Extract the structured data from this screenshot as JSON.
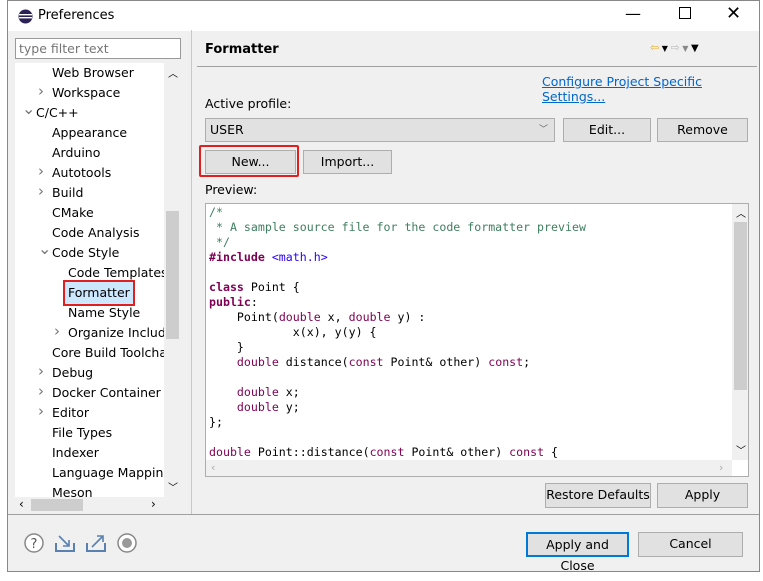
{
  "window": {
    "title": "Preferences",
    "controls": [
      "minimize",
      "maximize",
      "close"
    ]
  },
  "sidebar": {
    "filter_placeholder": "type filter text",
    "items": [
      {
        "label": "Web Browser",
        "level": 1,
        "chevron": ""
      },
      {
        "label": "Workspace",
        "level": 1,
        "chevron": "right"
      },
      {
        "label": "C/C++",
        "level": 0,
        "chevron": "down"
      },
      {
        "label": "Appearance",
        "level": 1,
        "chevron": ""
      },
      {
        "label": "Arduino",
        "level": 1,
        "chevron": ""
      },
      {
        "label": "Autotools",
        "level": 1,
        "chevron": "right"
      },
      {
        "label": "Build",
        "level": 1,
        "chevron": "right"
      },
      {
        "label": "CMake",
        "level": 1,
        "chevron": ""
      },
      {
        "label": "Code Analysis",
        "level": 1,
        "chevron": ""
      },
      {
        "label": "Code Style",
        "level": 1,
        "chevron": "down"
      },
      {
        "label": "Code Templates",
        "level": 2,
        "chevron": ""
      },
      {
        "label": "Formatter",
        "level": 2,
        "chevron": "",
        "selected": true
      },
      {
        "label": "Name Style",
        "level": 2,
        "chevron": ""
      },
      {
        "label": "Organize Includes",
        "level": 2,
        "chevron": "right"
      },
      {
        "label": "Core Build Toolchains",
        "level": 1,
        "chevron": ""
      },
      {
        "label": "Debug",
        "level": 1,
        "chevron": "right"
      },
      {
        "label": "Docker Container",
        "level": 1,
        "chevron": "right"
      },
      {
        "label": "Editor",
        "level": 1,
        "chevron": "right"
      },
      {
        "label": "File Types",
        "level": 1,
        "chevron": ""
      },
      {
        "label": "Indexer",
        "level": 1,
        "chevron": ""
      },
      {
        "label": "Language Mappings",
        "level": 1,
        "chevron": ""
      },
      {
        "label": "Meson",
        "level": 1,
        "chevron": ""
      }
    ]
  },
  "main": {
    "title": "Formatter",
    "config_link": "Configure Project Specific Settings...",
    "active_profile_label": "Active profile:",
    "profile_value": "USER",
    "edit_label": "Edit...",
    "remove_label": "Remove",
    "new_label": "New...",
    "import_label": "Import...",
    "preview_label": "Preview:",
    "code_lines": [
      [
        [
          "/*",
          "comment"
        ]
      ],
      [
        [
          " * A sample source file for the code formatter preview",
          "comment"
        ]
      ],
      [
        [
          " */",
          "comment"
        ]
      ],
      [
        [
          "#include",
          "kwb"
        ],
        [
          " ",
          ""
        ],
        [
          "<math.h>",
          "str"
        ]
      ],
      [],
      [
        [
          "class",
          "kwb"
        ],
        [
          " Point {",
          ""
        ]
      ],
      [
        [
          "public",
          "kwb"
        ],
        [
          ":",
          ""
        ]
      ],
      [
        [
          "    Point(",
          ""
        ],
        [
          "double",
          "kw"
        ],
        [
          " x, ",
          ""
        ],
        [
          "double",
          "kw"
        ],
        [
          " y) :",
          ""
        ]
      ],
      [
        [
          "            x(x), y(y) {",
          ""
        ]
      ],
      [
        [
          "    }",
          ""
        ]
      ],
      [
        [
          "    ",
          ""
        ],
        [
          "double",
          "kw"
        ],
        [
          " distance(",
          ""
        ],
        [
          "const",
          "kw"
        ],
        [
          " Point& other) ",
          ""
        ],
        [
          "const",
          "kw"
        ],
        [
          ";",
          ""
        ]
      ],
      [],
      [
        [
          "    ",
          ""
        ],
        [
          "double",
          "kw"
        ],
        [
          " x;",
          ""
        ]
      ],
      [
        [
          "    ",
          ""
        ],
        [
          "double",
          "kw"
        ],
        [
          " y;",
          ""
        ]
      ],
      [
        [
          "};",
          ""
        ]
      ],
      [],
      [
        [
          "double",
          "kw"
        ],
        [
          " Point::distance(",
          ""
        ],
        [
          "const",
          "kw"
        ],
        [
          " Point& other) ",
          ""
        ],
        [
          "const",
          "kw"
        ],
        [
          " {",
          ""
        ]
      ]
    ],
    "restore_defaults_label": "Restore Defaults",
    "apply_label": "Apply"
  },
  "footer": {
    "apply_close_label": "Apply and Close",
    "cancel_label": "Cancel",
    "icons": [
      "help-icon",
      "import-icon",
      "export-icon",
      "record-icon"
    ]
  },
  "colors": {
    "highlight": "#e02020",
    "link": "#0066cc",
    "keyword": "#7f0055",
    "comment": "#3f7f5f",
    "string": "#2a00ff"
  }
}
